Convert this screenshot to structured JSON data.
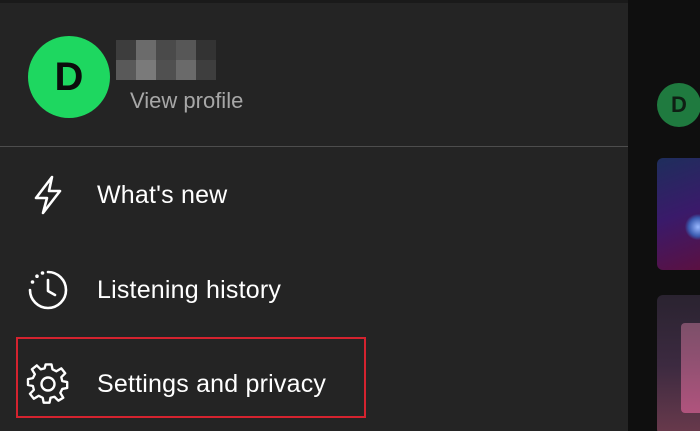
{
  "profile": {
    "avatar_initial": "D",
    "view_profile_label": "View profile",
    "avatar_color": "#1ed760",
    "username_pixelated": true
  },
  "menu": {
    "items": [
      {
        "label": "What's new",
        "icon": "lightning-bolt-icon"
      },
      {
        "label": "Listening history",
        "icon": "clock-history-icon"
      },
      {
        "label": "Settings and privacy",
        "icon": "gear-icon",
        "highlighted": true
      }
    ]
  },
  "background_screen": {
    "avatar_initial": "D"
  },
  "colors": {
    "drawer_background": "#242424",
    "text_primary": "#ffffff",
    "text_secondary": "#a7a7a7",
    "highlight_border": "#d4232f"
  }
}
